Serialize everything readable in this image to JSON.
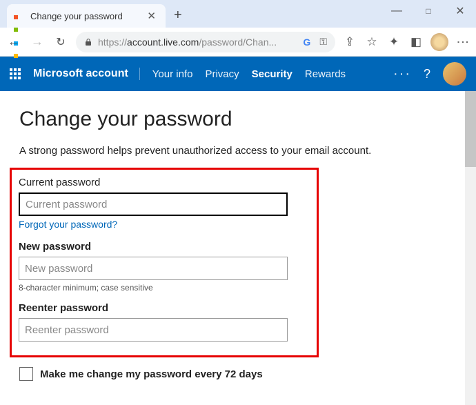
{
  "browser": {
    "tab_title": "Change your password",
    "url_display_prefix": "https://",
    "url_display_main": "account.live.com",
    "url_display_path": "/password/Chan..."
  },
  "header": {
    "brand": "Microsoft account",
    "nav": {
      "your_info": "Your info",
      "privacy": "Privacy",
      "security": "Security",
      "rewards": "Rewards"
    },
    "more": "···",
    "help": "?"
  },
  "page": {
    "title": "Change your password",
    "intro": "A strong password helps prevent unauthorized access to your email account.",
    "fields": {
      "current": {
        "label": "Current password",
        "placeholder": "Current password",
        "forgot_link": "Forgot your password?"
      },
      "new": {
        "label": "New password",
        "placeholder": "New password",
        "hint": "8-character minimum; case sensitive"
      },
      "reenter": {
        "label": "Reenter password",
        "placeholder": "Reenter password"
      }
    },
    "checkbox_label": "Make me change my password every 72 days"
  }
}
